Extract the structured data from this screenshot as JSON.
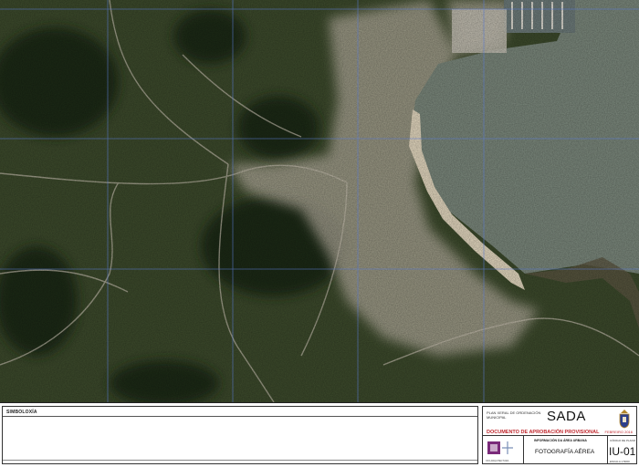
{
  "map": {
    "type": "aerial photograph",
    "colors": {
      "vegetation": "#3d4b2c",
      "forest": "#1f2c18",
      "urban": "#b9b1a2",
      "sea": "#7d8a7e",
      "beach": "#e8dcc3",
      "grid": "#5a7ad0"
    }
  },
  "legend": {
    "title": "SIMBOLOXÍA"
  },
  "title_block": {
    "plan_text": "PLAN XERAL DE ORDENACIÓN MUNICIPAL",
    "municipality": "SADA",
    "document": "DOCUMENTO DE APROBACIÓN PROVISIONAL",
    "date": "FEBREIRO 2016",
    "info": "INFORMACIÓN DA ÁREA URBANA",
    "sheet_title": "FOTOGRAFÍA AÉREA",
    "code_label": "CÓDIGO DE PLANO",
    "code": "IU-01",
    "scale_label": "ESCALA 1:5000",
    "logo_label": "XXX ARQUITECTURA"
  }
}
